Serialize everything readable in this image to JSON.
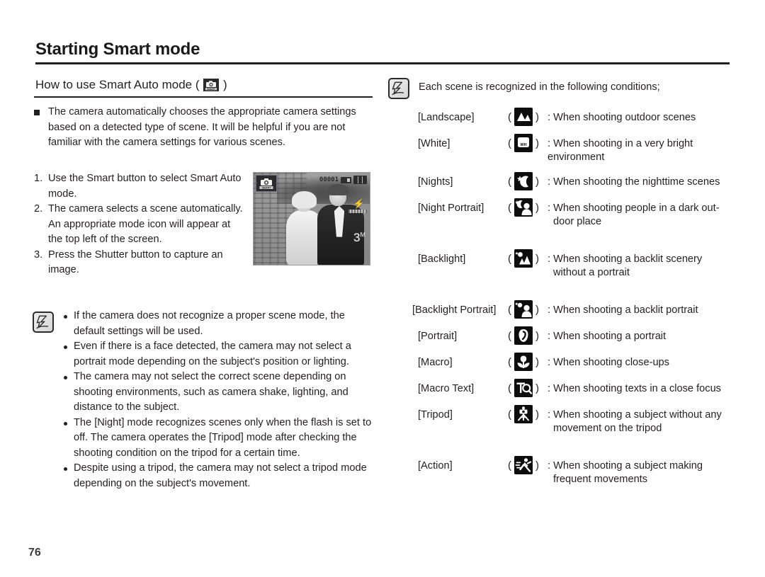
{
  "page": {
    "title": "Starting Smart mode",
    "number": "76"
  },
  "subheading": {
    "text_before": "How to use Smart Auto mode ( ",
    "text_after": " )",
    "icon": "smart-auto-badge-icon"
  },
  "intro": {
    "marker": "square-bullet",
    "text": "The camera automatically chooses the appropriate camera settings based on a detected type of scene. It will be helpful if you are not familiar with the camera settings for various scenes."
  },
  "steps": [
    {
      "marker": "1.",
      "text": "Use the Smart button to select Smart Auto mode."
    },
    {
      "marker": "2.",
      "text": "The camera selects a scene automatically. An appropriate mode icon will appear at the top left of the screen."
    },
    {
      "marker": "3.",
      "text": "Press the Shutter button to capture an image."
    }
  ],
  "lcd_sample": {
    "mode_icon": "smart-auto-badge-icon",
    "shots_remaining": "00001",
    "card_icon": "memory-card-icon",
    "battery_icon": "battery-full-icon",
    "flash_icon": "flash-icon",
    "image_size": "3",
    "image_size_unit": "M"
  },
  "left_note": {
    "icon": "note-pen-icon",
    "bullets": [
      "If the camera does not recognize a proper scene mode, the default settings will be used.",
      "Even if there is a face detected, the camera may not select a portrait mode depending on the subject's position or lighting.",
      "The camera may not select the correct scene depending on shooting environments, such as camera shake, lighting, and distance to the subject.",
      "The [Night] mode recognizes scenes only when the flash is set to off. The camera operates the [Tripod] mode after checking the shooting condition on the tripod for a certain time.",
      "Despite using a tripod, the camera may not select a tripod mode depending on the subject's movement."
    ]
  },
  "right_note": {
    "icon": "note-pen-icon",
    "text": "Each scene is recognized in the following conditions;"
  },
  "scenes": [
    {
      "label": "[Landscape]",
      "icon": "landscape-icon",
      "paren_open": "(",
      "paren_close": ")",
      "desc": ": When shooting outdoor scenes",
      "desc_cont": ""
    },
    {
      "label": "[White]",
      "icon": "white-balance-icon",
      "paren_open": "(",
      "paren_close": ")",
      "desc": ": When shooting in a very bright environment",
      "desc_cont": ""
    },
    {
      "label": "[Nights]",
      "icon": "night-icon",
      "paren_open": "(",
      "paren_close": ")",
      "desc": ": When shooting the nighttime scenes",
      "desc_cont": ""
    },
    {
      "label": "[Night Portrait]",
      "icon": "night-portrait-icon",
      "paren_open": "(",
      "paren_close": ")",
      "desc": ": When shooting people in a dark out-",
      "desc_cont": "door place"
    },
    {
      "label": "[Backlight]",
      "icon": "backlight-icon",
      "paren_open": "(",
      "paren_close": ")",
      "desc": ": When shooting a backlit scenery",
      "desc_cont": "without a portrait"
    },
    {
      "label": "[Backlight Portrait]",
      "icon": "backlight-portrait-icon",
      "paren_open": "(",
      "paren_close": ")",
      "desc": ": When shooting a backlit portrait",
      "desc_cont": ""
    },
    {
      "label": "[Portrait]",
      "icon": "portrait-icon",
      "paren_open": "(",
      "paren_close": ")",
      "desc": ": When shooting a portrait",
      "desc_cont": ""
    },
    {
      "label": "[Macro]",
      "icon": "macro-flower-icon",
      "paren_open": "(",
      "paren_close": ")",
      "desc": ": When shooting close-ups",
      "desc_cont": ""
    },
    {
      "label": "[Macro Text]",
      "icon": "macro-text-icon",
      "paren_open": "(",
      "paren_close": ")",
      "desc": ": When shooting texts in a close focus",
      "desc_cont": ""
    },
    {
      "label": "[Tripod]",
      "icon": "tripod-icon",
      "paren_open": "(",
      "paren_close": ")",
      "desc": ": When shooting a subject without any",
      "desc_cont": "movement on the tripod"
    },
    {
      "label": "[Action]",
      "icon": "action-icon",
      "paren_open": "(",
      "paren_close": ")",
      "desc": ": When shooting a subject making",
      "desc_cont": "frequent movements"
    }
  ],
  "colors": {
    "ink": "#231f20",
    "icon_bg": "#0d0d0d",
    "icon_fg": "#ffffff"
  }
}
